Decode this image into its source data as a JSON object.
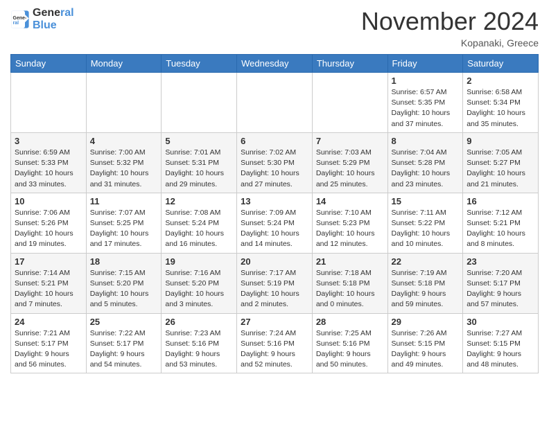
{
  "header": {
    "logo_line1": "General",
    "logo_line2": "Blue",
    "month": "November 2024",
    "location": "Kopanaki, Greece"
  },
  "weekdays": [
    "Sunday",
    "Monday",
    "Tuesday",
    "Wednesday",
    "Thursday",
    "Friday",
    "Saturday"
  ],
  "weeks": [
    [
      {
        "day": "",
        "info": ""
      },
      {
        "day": "",
        "info": ""
      },
      {
        "day": "",
        "info": ""
      },
      {
        "day": "",
        "info": ""
      },
      {
        "day": "",
        "info": ""
      },
      {
        "day": "1",
        "info": "Sunrise: 6:57 AM\nSunset: 5:35 PM\nDaylight: 10 hours\nand 37 minutes."
      },
      {
        "day": "2",
        "info": "Sunrise: 6:58 AM\nSunset: 5:34 PM\nDaylight: 10 hours\nand 35 minutes."
      }
    ],
    [
      {
        "day": "3",
        "info": "Sunrise: 6:59 AM\nSunset: 5:33 PM\nDaylight: 10 hours\nand 33 minutes."
      },
      {
        "day": "4",
        "info": "Sunrise: 7:00 AM\nSunset: 5:32 PM\nDaylight: 10 hours\nand 31 minutes."
      },
      {
        "day": "5",
        "info": "Sunrise: 7:01 AM\nSunset: 5:31 PM\nDaylight: 10 hours\nand 29 minutes."
      },
      {
        "day": "6",
        "info": "Sunrise: 7:02 AM\nSunset: 5:30 PM\nDaylight: 10 hours\nand 27 minutes."
      },
      {
        "day": "7",
        "info": "Sunrise: 7:03 AM\nSunset: 5:29 PM\nDaylight: 10 hours\nand 25 minutes."
      },
      {
        "day": "8",
        "info": "Sunrise: 7:04 AM\nSunset: 5:28 PM\nDaylight: 10 hours\nand 23 minutes."
      },
      {
        "day": "9",
        "info": "Sunrise: 7:05 AM\nSunset: 5:27 PM\nDaylight: 10 hours\nand 21 minutes."
      }
    ],
    [
      {
        "day": "10",
        "info": "Sunrise: 7:06 AM\nSunset: 5:26 PM\nDaylight: 10 hours\nand 19 minutes."
      },
      {
        "day": "11",
        "info": "Sunrise: 7:07 AM\nSunset: 5:25 PM\nDaylight: 10 hours\nand 17 minutes."
      },
      {
        "day": "12",
        "info": "Sunrise: 7:08 AM\nSunset: 5:24 PM\nDaylight: 10 hours\nand 16 minutes."
      },
      {
        "day": "13",
        "info": "Sunrise: 7:09 AM\nSunset: 5:24 PM\nDaylight: 10 hours\nand 14 minutes."
      },
      {
        "day": "14",
        "info": "Sunrise: 7:10 AM\nSunset: 5:23 PM\nDaylight: 10 hours\nand 12 minutes."
      },
      {
        "day": "15",
        "info": "Sunrise: 7:11 AM\nSunset: 5:22 PM\nDaylight: 10 hours\nand 10 minutes."
      },
      {
        "day": "16",
        "info": "Sunrise: 7:12 AM\nSunset: 5:21 PM\nDaylight: 10 hours\nand 8 minutes."
      }
    ],
    [
      {
        "day": "17",
        "info": "Sunrise: 7:14 AM\nSunset: 5:21 PM\nDaylight: 10 hours\nand 7 minutes."
      },
      {
        "day": "18",
        "info": "Sunrise: 7:15 AM\nSunset: 5:20 PM\nDaylight: 10 hours\nand 5 minutes."
      },
      {
        "day": "19",
        "info": "Sunrise: 7:16 AM\nSunset: 5:20 PM\nDaylight: 10 hours\nand 3 minutes."
      },
      {
        "day": "20",
        "info": "Sunrise: 7:17 AM\nSunset: 5:19 PM\nDaylight: 10 hours\nand 2 minutes."
      },
      {
        "day": "21",
        "info": "Sunrise: 7:18 AM\nSunset: 5:18 PM\nDaylight: 10 hours\nand 0 minutes."
      },
      {
        "day": "22",
        "info": "Sunrise: 7:19 AM\nSunset: 5:18 PM\nDaylight: 9 hours\nand 59 minutes."
      },
      {
        "day": "23",
        "info": "Sunrise: 7:20 AM\nSunset: 5:17 PM\nDaylight: 9 hours\nand 57 minutes."
      }
    ],
    [
      {
        "day": "24",
        "info": "Sunrise: 7:21 AM\nSunset: 5:17 PM\nDaylight: 9 hours\nand 56 minutes."
      },
      {
        "day": "25",
        "info": "Sunrise: 7:22 AM\nSunset: 5:17 PM\nDaylight: 9 hours\nand 54 minutes."
      },
      {
        "day": "26",
        "info": "Sunrise: 7:23 AM\nSunset: 5:16 PM\nDaylight: 9 hours\nand 53 minutes."
      },
      {
        "day": "27",
        "info": "Sunrise: 7:24 AM\nSunset: 5:16 PM\nDaylight: 9 hours\nand 52 minutes."
      },
      {
        "day": "28",
        "info": "Sunrise: 7:25 AM\nSunset: 5:16 PM\nDaylight: 9 hours\nand 50 minutes."
      },
      {
        "day": "29",
        "info": "Sunrise: 7:26 AM\nSunset: 5:15 PM\nDaylight: 9 hours\nand 49 minutes."
      },
      {
        "day": "30",
        "info": "Sunrise: 7:27 AM\nSunset: 5:15 PM\nDaylight: 9 hours\nand 48 minutes."
      }
    ]
  ]
}
